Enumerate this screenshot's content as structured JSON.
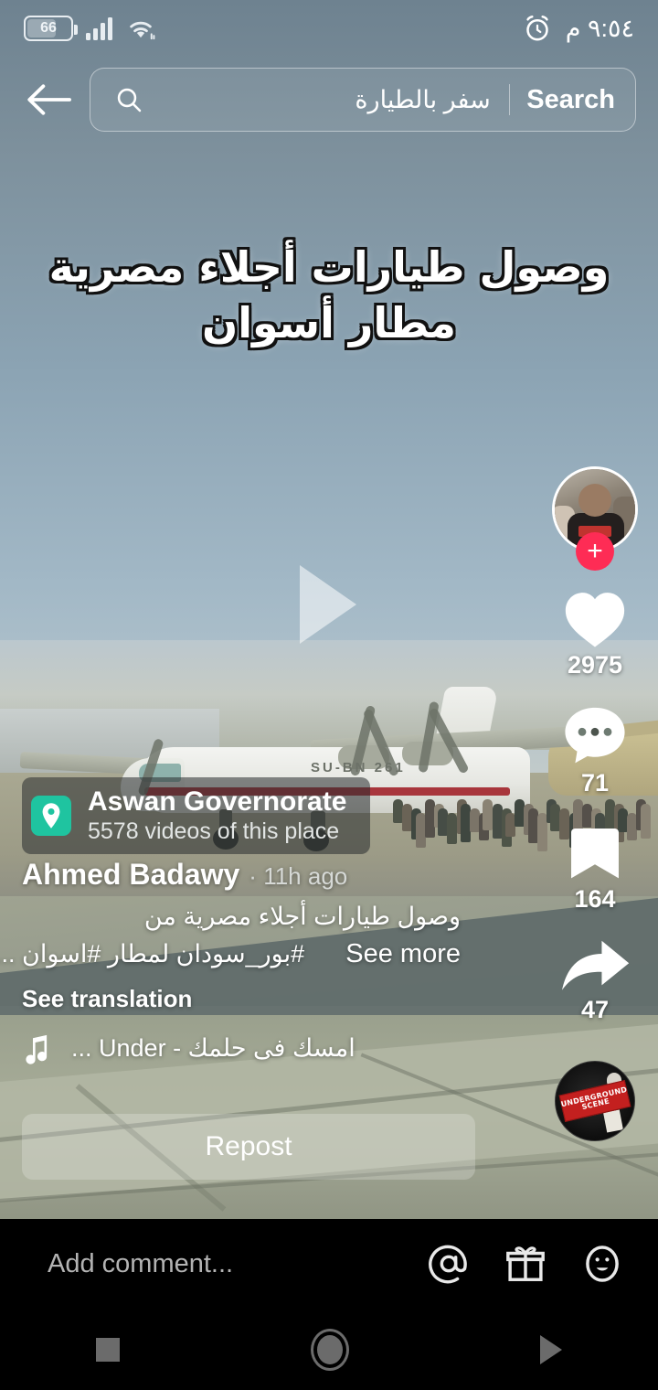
{
  "status_bar": {
    "battery_level": "66",
    "battery_icon": "battery-icon",
    "signal_icon": "signal-bars-icon",
    "wifi_icon": "wifi-icon",
    "alarm_icon": "alarm-clock-icon",
    "time": "٩:٥٤ م"
  },
  "header": {
    "back_icon": "back-arrow-icon",
    "search_icon": "search-icon",
    "search_value": "سفر بالطيارة",
    "search_placeholder": "Search",
    "search_button_label": "Search"
  },
  "video": {
    "overlay_text_line1": "وصول طيارات أجلاء مصرية",
    "overlay_text_line2": "مطار أسوان",
    "play_icon": "play-triangle-icon",
    "state": "paused"
  },
  "actions": {
    "avatar_icon": "user-avatar",
    "follow_label": "+",
    "like": {
      "icon": "heart-icon",
      "count": "2975"
    },
    "comment": {
      "icon": "comment-bubble-icon",
      "count": "71"
    },
    "bookmark": {
      "icon": "bookmark-icon",
      "count": "164"
    },
    "share": {
      "icon": "share-arrow-icon",
      "count": "47"
    },
    "music_disc": {
      "icon": "music-disc-icon",
      "label_line1": "UNDERGROUND",
      "label_line2": "SCENE"
    }
  },
  "location": {
    "pin_icon": "location-pin-icon",
    "name": "Aswan Governorate",
    "subtitle": "5578 videos of this place",
    "pin_color": "#1fc4a0"
  },
  "post": {
    "author": "Ahmed Badawy",
    "separator": "·",
    "time_ago": "11h ago",
    "caption_line1": "وصول طيارات أجلاء مصرية من",
    "caption_line2": "#بور_سودان لمطار #اسوان ...",
    "see_more_label": "See more",
    "see_translation_label": "See translation",
    "music_icon": "music-note-icon",
    "music_title": "امسك فى حلمك - Under ...",
    "repost_label": "Repost"
  },
  "comment_bar": {
    "placeholder": "Add comment...",
    "mention_icon": "at-mention-icon",
    "gift_icon": "gift-icon",
    "emoji_icon": "emoji-smiley-icon"
  },
  "nav_bar": {
    "recents_icon": "recents-square-icon",
    "home_icon": "home-circle-icon",
    "back_icon": "back-triangle-icon"
  },
  "colors": {
    "accent_red": "#fe2c55",
    "location_green": "#1fc4a0",
    "bar_black": "#000000"
  }
}
